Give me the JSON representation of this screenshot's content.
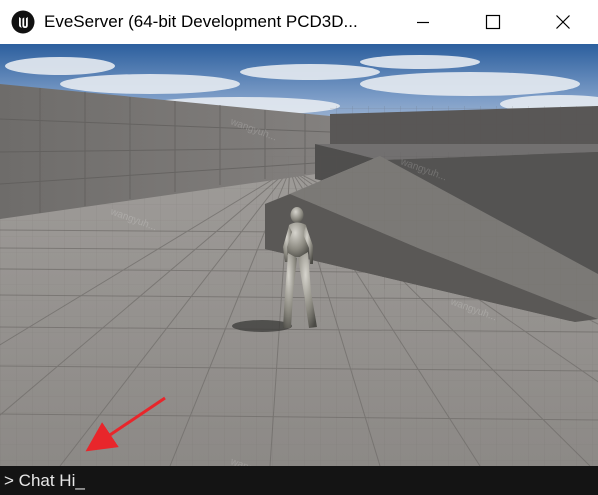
{
  "window": {
    "title": "EveServer (64-bit Development PCD3D..."
  },
  "titlebar": {
    "icons": [
      "unreal-engine-logo-icon",
      "minimize-icon",
      "maximize-icon",
      "close-icon"
    ]
  },
  "console": {
    "prompt": ">",
    "input_value": "Chat Hi_"
  },
  "annotation": {
    "arrow_color": "#e8262b"
  },
  "watermark": {
    "text": "wangyuh..."
  }
}
